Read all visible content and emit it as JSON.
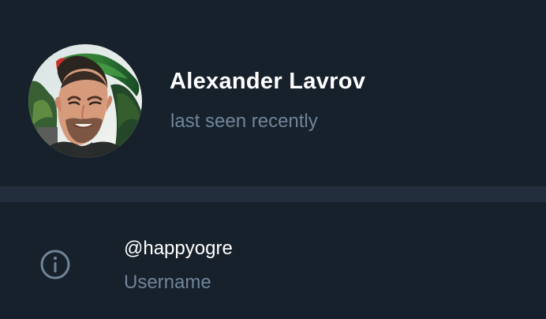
{
  "profile": {
    "name": "Alexander Lavrov",
    "status": "last seen recently",
    "avatar_icon": "user-photo-avatar"
  },
  "info": {
    "icon": "info-icon",
    "username": "@happyogre",
    "username_label": "Username"
  },
  "colors": {
    "background": "#17212b",
    "divider": "#232e3c",
    "primary_text": "#ffffff",
    "secondary_text": "#708499"
  }
}
